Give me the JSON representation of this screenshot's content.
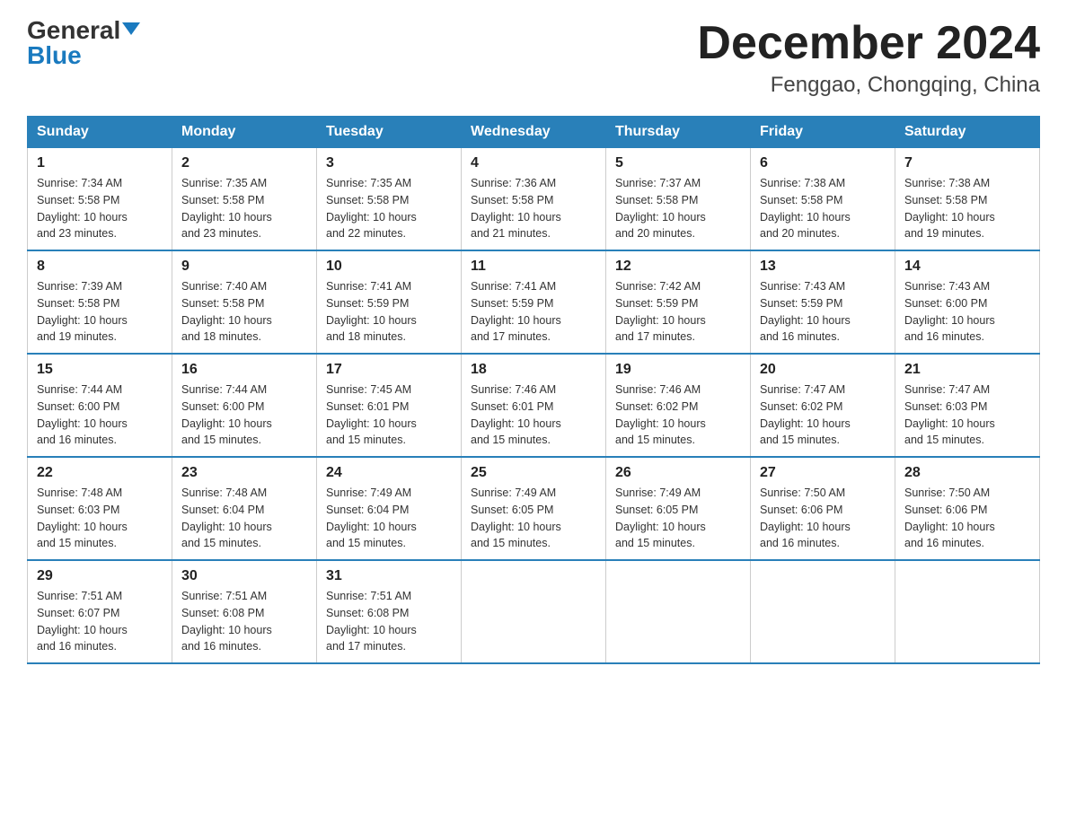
{
  "logo": {
    "general": "General",
    "blue": "Blue"
  },
  "title": "December 2024",
  "subtitle": "Fenggao, Chongqing, China",
  "days_of_week": [
    "Sunday",
    "Monday",
    "Tuesday",
    "Wednesday",
    "Thursday",
    "Friday",
    "Saturday"
  ],
  "weeks": [
    [
      {
        "day": "1",
        "info": "Sunrise: 7:34 AM\nSunset: 5:58 PM\nDaylight: 10 hours\nand 23 minutes."
      },
      {
        "day": "2",
        "info": "Sunrise: 7:35 AM\nSunset: 5:58 PM\nDaylight: 10 hours\nand 23 minutes."
      },
      {
        "day": "3",
        "info": "Sunrise: 7:35 AM\nSunset: 5:58 PM\nDaylight: 10 hours\nand 22 minutes."
      },
      {
        "day": "4",
        "info": "Sunrise: 7:36 AM\nSunset: 5:58 PM\nDaylight: 10 hours\nand 21 minutes."
      },
      {
        "day": "5",
        "info": "Sunrise: 7:37 AM\nSunset: 5:58 PM\nDaylight: 10 hours\nand 20 minutes."
      },
      {
        "day": "6",
        "info": "Sunrise: 7:38 AM\nSunset: 5:58 PM\nDaylight: 10 hours\nand 20 minutes."
      },
      {
        "day": "7",
        "info": "Sunrise: 7:38 AM\nSunset: 5:58 PM\nDaylight: 10 hours\nand 19 minutes."
      }
    ],
    [
      {
        "day": "8",
        "info": "Sunrise: 7:39 AM\nSunset: 5:58 PM\nDaylight: 10 hours\nand 19 minutes."
      },
      {
        "day": "9",
        "info": "Sunrise: 7:40 AM\nSunset: 5:58 PM\nDaylight: 10 hours\nand 18 minutes."
      },
      {
        "day": "10",
        "info": "Sunrise: 7:41 AM\nSunset: 5:59 PM\nDaylight: 10 hours\nand 18 minutes."
      },
      {
        "day": "11",
        "info": "Sunrise: 7:41 AM\nSunset: 5:59 PM\nDaylight: 10 hours\nand 17 minutes."
      },
      {
        "day": "12",
        "info": "Sunrise: 7:42 AM\nSunset: 5:59 PM\nDaylight: 10 hours\nand 17 minutes."
      },
      {
        "day": "13",
        "info": "Sunrise: 7:43 AM\nSunset: 5:59 PM\nDaylight: 10 hours\nand 16 minutes."
      },
      {
        "day": "14",
        "info": "Sunrise: 7:43 AM\nSunset: 6:00 PM\nDaylight: 10 hours\nand 16 minutes."
      }
    ],
    [
      {
        "day": "15",
        "info": "Sunrise: 7:44 AM\nSunset: 6:00 PM\nDaylight: 10 hours\nand 16 minutes."
      },
      {
        "day": "16",
        "info": "Sunrise: 7:44 AM\nSunset: 6:00 PM\nDaylight: 10 hours\nand 15 minutes."
      },
      {
        "day": "17",
        "info": "Sunrise: 7:45 AM\nSunset: 6:01 PM\nDaylight: 10 hours\nand 15 minutes."
      },
      {
        "day": "18",
        "info": "Sunrise: 7:46 AM\nSunset: 6:01 PM\nDaylight: 10 hours\nand 15 minutes."
      },
      {
        "day": "19",
        "info": "Sunrise: 7:46 AM\nSunset: 6:02 PM\nDaylight: 10 hours\nand 15 minutes."
      },
      {
        "day": "20",
        "info": "Sunrise: 7:47 AM\nSunset: 6:02 PM\nDaylight: 10 hours\nand 15 minutes."
      },
      {
        "day": "21",
        "info": "Sunrise: 7:47 AM\nSunset: 6:03 PM\nDaylight: 10 hours\nand 15 minutes."
      }
    ],
    [
      {
        "day": "22",
        "info": "Sunrise: 7:48 AM\nSunset: 6:03 PM\nDaylight: 10 hours\nand 15 minutes."
      },
      {
        "day": "23",
        "info": "Sunrise: 7:48 AM\nSunset: 6:04 PM\nDaylight: 10 hours\nand 15 minutes."
      },
      {
        "day": "24",
        "info": "Sunrise: 7:49 AM\nSunset: 6:04 PM\nDaylight: 10 hours\nand 15 minutes."
      },
      {
        "day": "25",
        "info": "Sunrise: 7:49 AM\nSunset: 6:05 PM\nDaylight: 10 hours\nand 15 minutes."
      },
      {
        "day": "26",
        "info": "Sunrise: 7:49 AM\nSunset: 6:05 PM\nDaylight: 10 hours\nand 15 minutes."
      },
      {
        "day": "27",
        "info": "Sunrise: 7:50 AM\nSunset: 6:06 PM\nDaylight: 10 hours\nand 16 minutes."
      },
      {
        "day": "28",
        "info": "Sunrise: 7:50 AM\nSunset: 6:06 PM\nDaylight: 10 hours\nand 16 minutes."
      }
    ],
    [
      {
        "day": "29",
        "info": "Sunrise: 7:51 AM\nSunset: 6:07 PM\nDaylight: 10 hours\nand 16 minutes."
      },
      {
        "day": "30",
        "info": "Sunrise: 7:51 AM\nSunset: 6:08 PM\nDaylight: 10 hours\nand 16 minutes."
      },
      {
        "day": "31",
        "info": "Sunrise: 7:51 AM\nSunset: 6:08 PM\nDaylight: 10 hours\nand 17 minutes."
      },
      {
        "day": "",
        "info": ""
      },
      {
        "day": "",
        "info": ""
      },
      {
        "day": "",
        "info": ""
      },
      {
        "day": "",
        "info": ""
      }
    ]
  ]
}
